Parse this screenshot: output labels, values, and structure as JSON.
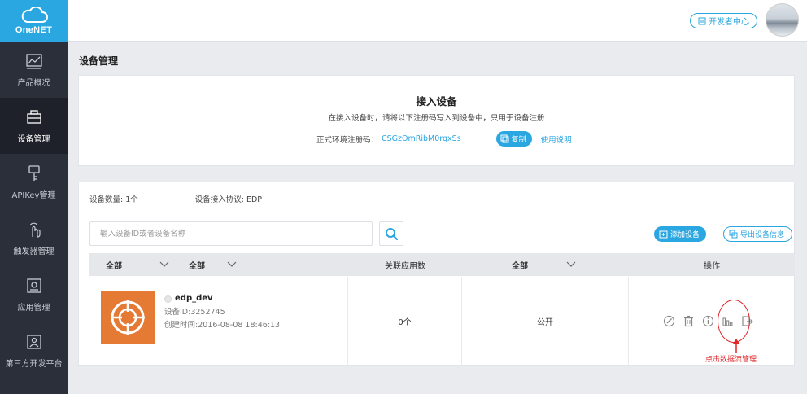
{
  "sidebar": {
    "brand": "OneNET",
    "items": [
      {
        "label": "产品概况",
        "icon": "chart-line-icon",
        "active": false
      },
      {
        "label": "设备管理",
        "icon": "device-icon",
        "active": true
      },
      {
        "label": "APIKey管理",
        "icon": "key-icon",
        "active": false
      },
      {
        "label": "触发器管理",
        "icon": "hand-tap-icon",
        "active": false
      },
      {
        "label": "应用管理",
        "icon": "app-icon",
        "active": false
      },
      {
        "label": "第三方开发平台",
        "icon": "third-party-icon",
        "active": false
      }
    ]
  },
  "topbar": {
    "dev_center_label": "开发者中心"
  },
  "page": {
    "title": "设备管理"
  },
  "access": {
    "title": "接入设备",
    "description": "在接入设备时，请将以下注册码写入到设备中，只用于设备注册",
    "reg_label": "正式环境注册码：",
    "reg_code": "CSGzOmRibM0rqxSs",
    "copy_label": "复制",
    "usage_label": "使用说明"
  },
  "devices": {
    "count_text": "设备数量: 1个",
    "protocol_text": "设备接入协议: EDP",
    "search_placeholder": "输入设备ID或者设备名称",
    "add_label": "添加设备",
    "export_label": "导出设备信息",
    "headers": {
      "filter1": "全部",
      "filter2": "全部",
      "app_count": "关联应用数",
      "filter3": "全部",
      "operation": "操作"
    },
    "rows": [
      {
        "name": "edp_dev",
        "id_text": "设备ID:3252745",
        "created_text": "创建时间:2016-08-08 18:46:13",
        "app_count": "0个",
        "visibility": "公开"
      }
    ]
  },
  "annotation": {
    "text": "点击数据流管理",
    "color": "#e0282b"
  },
  "colors": {
    "accent": "#2aa6e0",
    "sidebar_bg": "#2b2f3a",
    "thumb_bg": "#e57a34"
  }
}
